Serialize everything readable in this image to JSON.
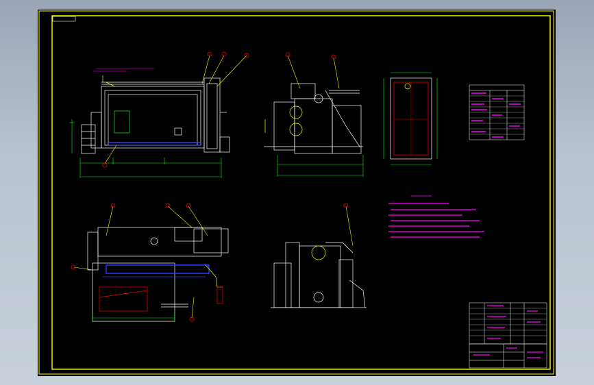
{
  "drawing": {
    "background": "#000000",
    "colors": {
      "frame": "#ffff00",
      "linework": "#ffffff",
      "dimensions": "#00ff00",
      "leaders": "#ffff00",
      "notes": "#ff00ff",
      "hidden": "#ff0000",
      "water_wall": "#2a3cff",
      "balloon": "#ff0000"
    },
    "views": [
      "front-elevation",
      "side-elevation",
      "plan-view",
      "section-view",
      "section-view-2"
    ],
    "tables": [
      "technical-spec-table",
      "parts-list-table",
      "title-block"
    ],
    "notes_block": "technical-requirements"
  }
}
